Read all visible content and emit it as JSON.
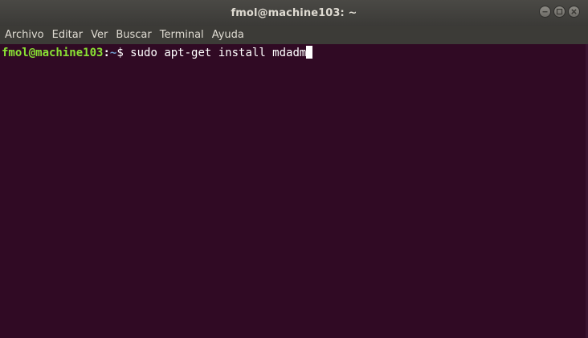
{
  "window": {
    "title": "fmol@machine103: ~"
  },
  "menubar": {
    "items": [
      {
        "label": "Archivo"
      },
      {
        "label": "Editar"
      },
      {
        "label": "Ver"
      },
      {
        "label": "Buscar"
      },
      {
        "label": "Terminal"
      },
      {
        "label": "Ayuda"
      }
    ]
  },
  "terminal": {
    "prompt_user_host": "fmol@machine103",
    "prompt_colon": ":",
    "prompt_path": "~",
    "prompt_symbol": "$",
    "command": " sudo apt-get install mdadm",
    "background": "#300a24",
    "user_color": "#8ae234",
    "path_color": "#729fcf"
  },
  "icons": {
    "minimize": "minimize-icon",
    "maximize": "maximize-icon",
    "close": "close-icon"
  }
}
